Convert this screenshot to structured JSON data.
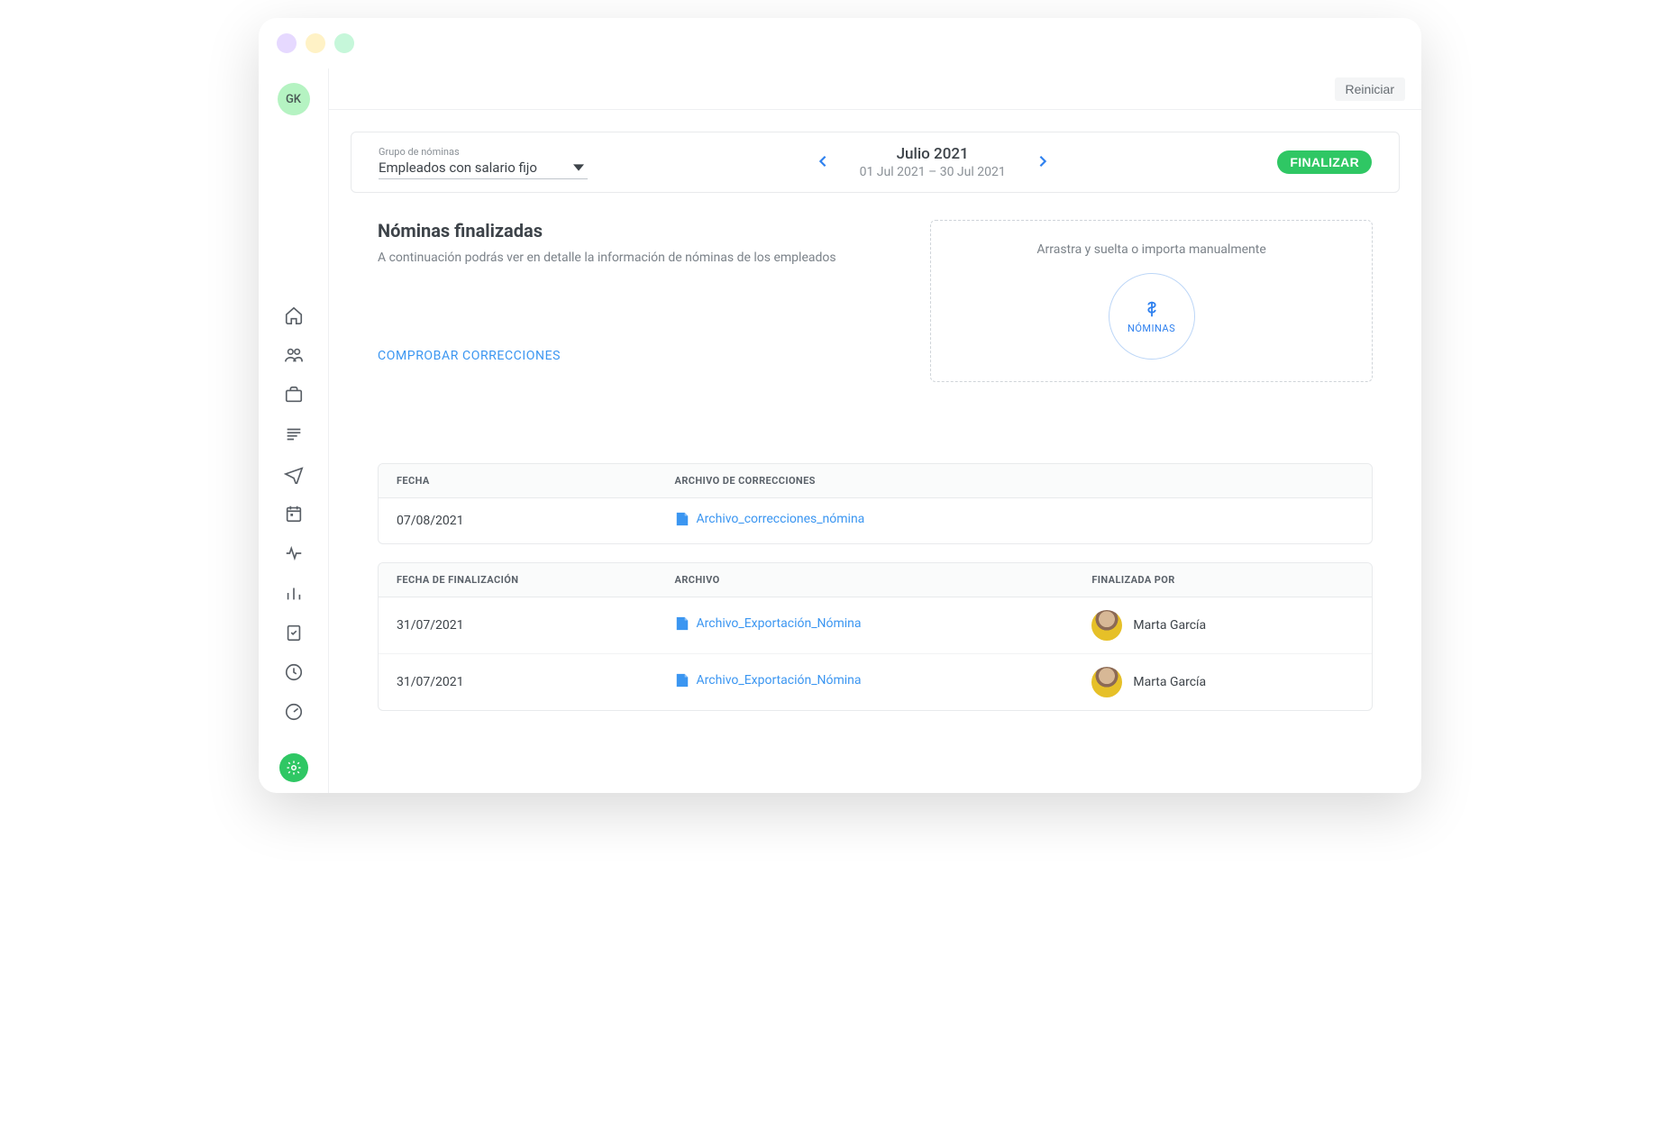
{
  "topbar": {
    "avatar_initials": "GK"
  },
  "header": {
    "restart_label": "Reiniciar"
  },
  "top_card": {
    "group_label": "Grupo de nóminas",
    "group_value": "Empleados con salario fijo",
    "period_title": "Julio 2021",
    "period_range": "01 Jul 2021 – 30 Jul 2021",
    "finalize_label": "FINALIZAR"
  },
  "body": {
    "section_title": "Nóminas finalizadas",
    "section_sub": "A continuación podrás ver en detalle la información de nóminas de los empleados",
    "check_link": "COMPROBAR CORRECCIONES",
    "drop_label": "Arrastra y suelta o importa manualmente",
    "drop_circle_label": "NÓMINAS"
  },
  "table1": {
    "headers": {
      "date": "FECHA",
      "file": "ARCHIVO DE CORRECCIONES"
    },
    "rows": [
      {
        "date": "07/08/2021",
        "file": "Archivo_correcciones_nómina"
      }
    ]
  },
  "table2": {
    "headers": {
      "date": "FECHA DE FINALIZACIÓN",
      "file": "ARCHIVO",
      "by": "FINALIZADA POR"
    },
    "rows": [
      {
        "date": "31/07/2021",
        "file": "Archivo_Exportación_Nómina",
        "by": "Marta García"
      },
      {
        "date": "31/07/2021",
        "file": "Archivo_Exportación_Nómina",
        "by": "Marta García"
      }
    ]
  }
}
